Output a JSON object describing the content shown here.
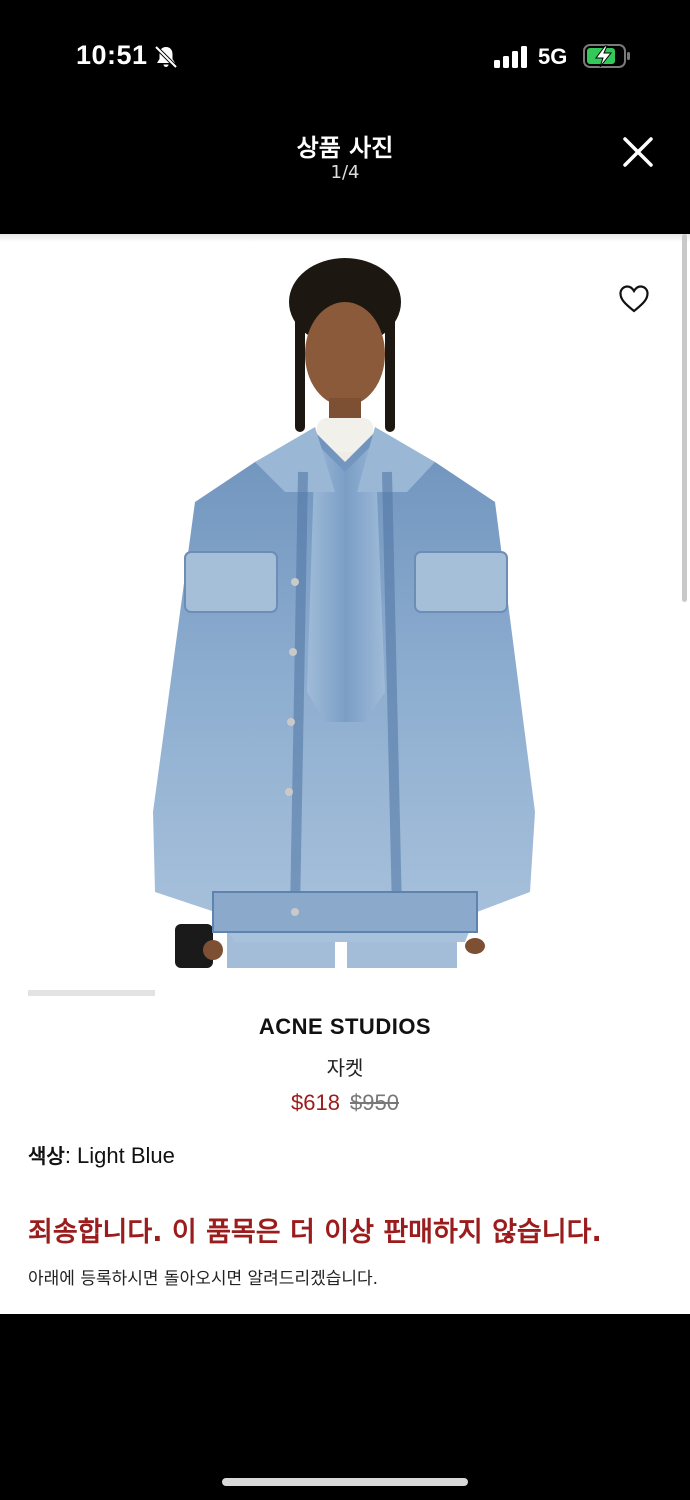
{
  "status_bar": {
    "time": "10:51",
    "network": "5G",
    "icons": [
      "bell-slash-icon",
      "signal-icon",
      "battery-charging-icon"
    ]
  },
  "header": {
    "title": "상품 사진",
    "counter": "1/4",
    "close_icon": "close-icon"
  },
  "product": {
    "brand": "ACNE STUDIOS",
    "name": "자켓",
    "sale_price": "$618",
    "original_price": "$950",
    "color_label": "색상",
    "color_value": ": Light Blue",
    "image_alt": "light blue denim jacket on model",
    "wishlist_icon": "heart-icon"
  },
  "availability": {
    "message": "죄송합니다. 이 품목은 더 이상 판매하지 않습니다.",
    "notify": "아래에 등록하시면 돌아오시면 알려드리겠습니다."
  },
  "colors": {
    "accent_red": "#9b1c1c",
    "denim": "#8fb0cf",
    "denim_dark": "#4f75a3"
  }
}
